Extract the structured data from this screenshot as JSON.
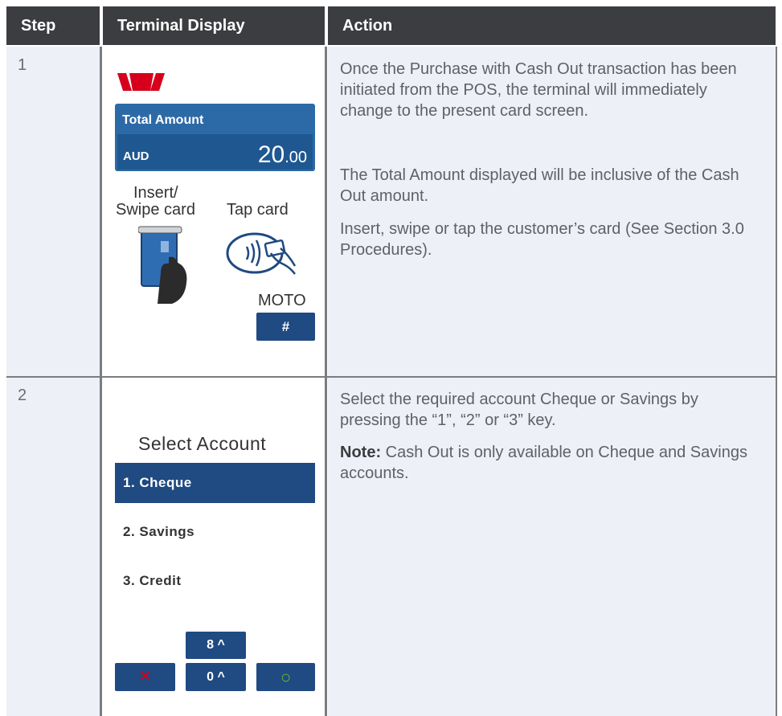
{
  "headers": {
    "step": "Step",
    "display": "Terminal Display",
    "action": "Action"
  },
  "rows": [
    {
      "step": "1",
      "terminal": {
        "amount_label": "Total Amount",
        "currency": "AUD",
        "amount_whole": "20",
        "amount_cents": ".00",
        "insert_label_1": "Insert/",
        "insert_label_2": "Swipe card",
        "tap_label": "Tap card",
        "moto_label": "MOTO",
        "hash_key": "#"
      },
      "action": [
        "Once the Purchase with Cash Out transaction has been initiated from the POS, the terminal will immediately change to the present card screen.",
        "The Total Amount displayed will be inclusive of the Cash Out amount.",
        "Insert, swipe or tap the customer’s card (See Section 3.0 Procedures)."
      ]
    },
    {
      "step": "2",
      "terminal": {
        "title": "Select Account",
        "options": [
          "1. Cheque",
          "2. Savings",
          "3. Credit"
        ],
        "key_up": "8 ^",
        "key_down": "0 ^",
        "cancel_key": "✕",
        "ok_key": "○"
      },
      "action_1": "Select the required account Cheque or Savings by pressing the “1”, “2” or “3” key.",
      "note_label": "Note:",
      "note_text": " Cash Out is only available on Cheque and Savings accounts."
    }
  ],
  "colors": {
    "header_bg": "#3c3d40",
    "cell_bg": "#eef0f7",
    "brand_red": "#d6001c",
    "screen_blue": "#2c6aa7",
    "key_blue": "#1f4a82"
  }
}
